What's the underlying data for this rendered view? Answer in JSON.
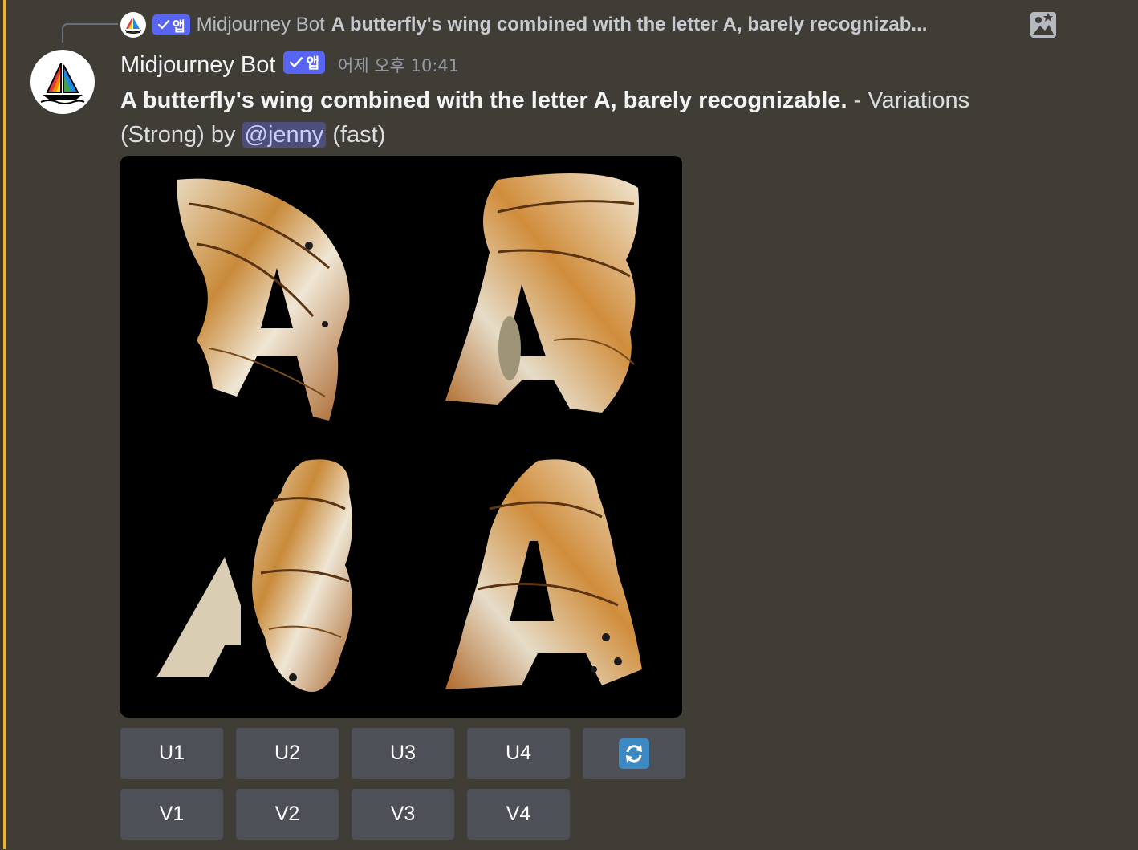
{
  "reply": {
    "author": "Midjourney Bot",
    "badge": "앱",
    "text": "A butterfly's wing combined with the letter A, barely recognizab...",
    "image_icon": "image-icon"
  },
  "message": {
    "author": "Midjourney Bot",
    "badge": "앱",
    "timestamp": "어제 오후 10:41",
    "prompt": "A butterfly's wing combined with the letter A, barely recognizable.",
    "suffix_before_mention": " - Variations (Strong) by ",
    "mention": "@jenny",
    "suffix_after_mention": " (fast)"
  },
  "image": {
    "description_icon": "butterfly-letter-a-grid"
  },
  "buttons": {
    "row1": [
      "U1",
      "U2",
      "U3",
      "U4"
    ],
    "row2": [
      "V1",
      "V2",
      "V3",
      "V4"
    ],
    "reroll_icon": "refresh-icon"
  },
  "colors": {
    "background": "#403d36",
    "accent_stripe": "#f0b232",
    "badge": "#5865f2",
    "button": "#4e5058",
    "mention_bg": "#4d4e7a"
  }
}
